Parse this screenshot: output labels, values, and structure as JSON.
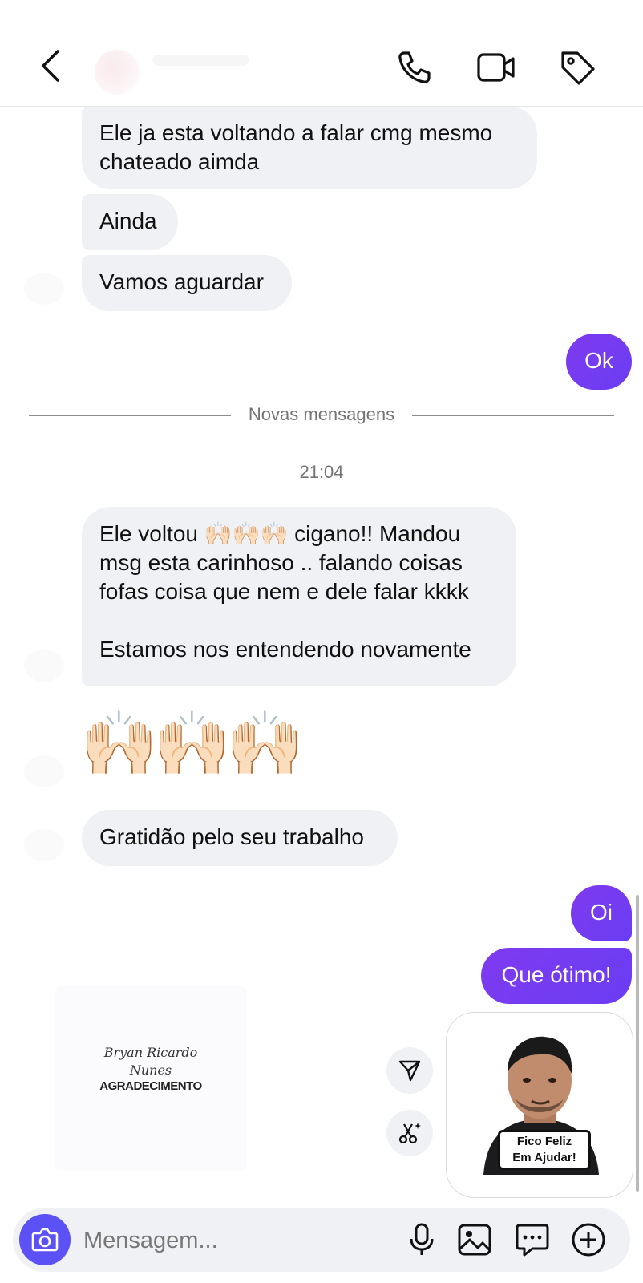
{
  "header": {
    "back_icon": "chevron-left-icon",
    "actions": [
      "phone-icon",
      "video-camera-icon",
      "tag-icon"
    ]
  },
  "messages": {
    "m1": "Ele ja esta voltando a falar cmg mesmo\nchateado aimda",
    "m2": "Ainda",
    "m3": "Vamos aguardar",
    "m4": "Ok",
    "m5": "Ele voltou 🙌🏻🙌🏻🙌🏻 cigano!! Mandou\nmsg esta carinhoso .. falando coisas\nfofas coisa que nem e dele falar kkkk\n\nEstamos nos entendendo novamente",
    "m6_emoji": "🙌🏻🙌🏻🙌🏻",
    "m7": "Gratidão pelo seu trabalho",
    "m8": "Oi",
    "m9": "Que ótimo!"
  },
  "divider": {
    "label": "Novas mensagens"
  },
  "timestamp": "21:04",
  "sticker_card": {
    "signature_line1": "Bryan Ricardo",
    "signature_line2": "Nunes",
    "title": "AGRADECIMENTO"
  },
  "sticker_message": {
    "caption_line1": "Fico Feliz",
    "caption_line2": "Em Ajudar!"
  },
  "composer": {
    "placeholder": "Mensagem...",
    "icons": [
      "camera-icon",
      "microphone-icon",
      "image-icon",
      "chat-bubble-icon",
      "plus-icon"
    ]
  },
  "colors": {
    "outgoing_bubble": "#7f3bf0",
    "incoming_bubble": "#eff1f4",
    "camera_button": "#5b51f5"
  }
}
